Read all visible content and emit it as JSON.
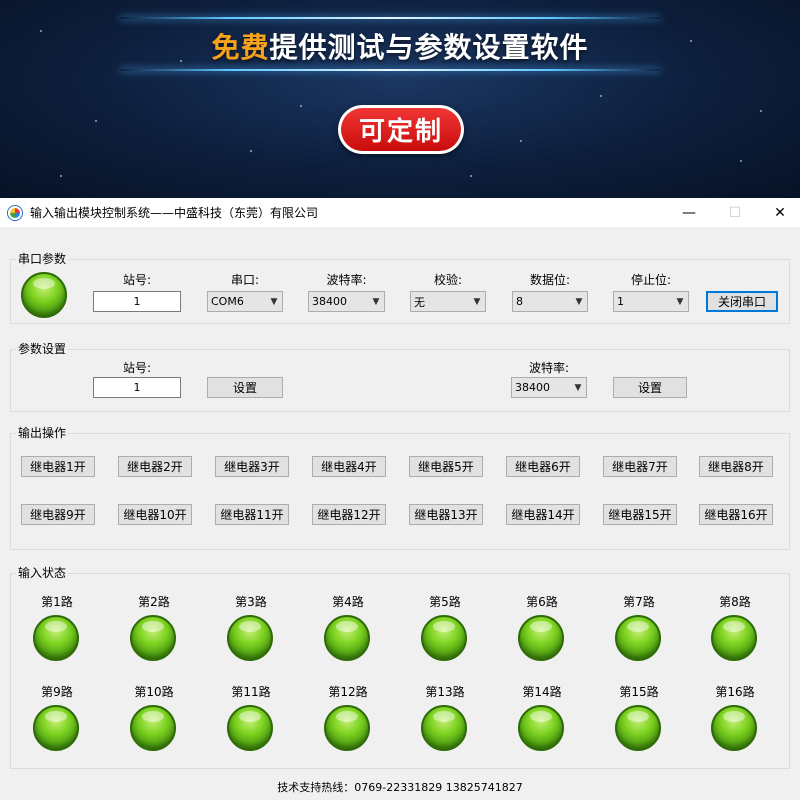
{
  "banner": {
    "title_accent": "免费",
    "title_rest": "提供测试与参数设置软件",
    "badge": "可定制"
  },
  "window": {
    "title": "输入输出模块控制系统——中盛科技（东莞）有限公司",
    "minimize": "—",
    "maximize": "☐",
    "close": "✕"
  },
  "serial": {
    "group_title": "串口参数",
    "station_label": "站号:",
    "station_value": "1",
    "port_label": "串口:",
    "port_value": "COM6",
    "baud_label": "波特率:",
    "baud_value": "38400",
    "parity_label": "校验:",
    "parity_value": "无",
    "databits_label": "数据位:",
    "databits_value": "8",
    "stopbits_label": "停止位:",
    "stopbits_value": "1",
    "close_button": "关闭串口"
  },
  "params": {
    "group_title": "参数设置",
    "station_label": "站号:",
    "station_value": "1",
    "set_button_1": "设置",
    "baud_label": "波特率:",
    "baud_value": "38400",
    "set_button_2": "设置"
  },
  "outputs": {
    "group_title": "输出操作",
    "buttons": [
      "继电器1开",
      "继电器2开",
      "继电器3开",
      "继电器4开",
      "继电器5开",
      "继电器6开",
      "继电器7开",
      "继电器8开",
      "继电器9开",
      "继电器10开",
      "继电器11开",
      "继电器12开",
      "继电器13开",
      "继电器14开",
      "继电器15开",
      "继电器16开"
    ]
  },
  "inputs": {
    "group_title": "输入状态",
    "channels": [
      "第1路",
      "第2路",
      "第3路",
      "第4路",
      "第5路",
      "第6路",
      "第7路",
      "第8路",
      "第9路",
      "第10路",
      "第11路",
      "第12路",
      "第13路",
      "第14路",
      "第15路",
      "第16路"
    ],
    "led_color": "#7ed321"
  },
  "footer": "技术支持热线：0769-22331829 13825741827",
  "colors": {
    "banner_accent": "#f7a21b",
    "badge_red": "#e02020",
    "led_green": "#7ed321"
  }
}
